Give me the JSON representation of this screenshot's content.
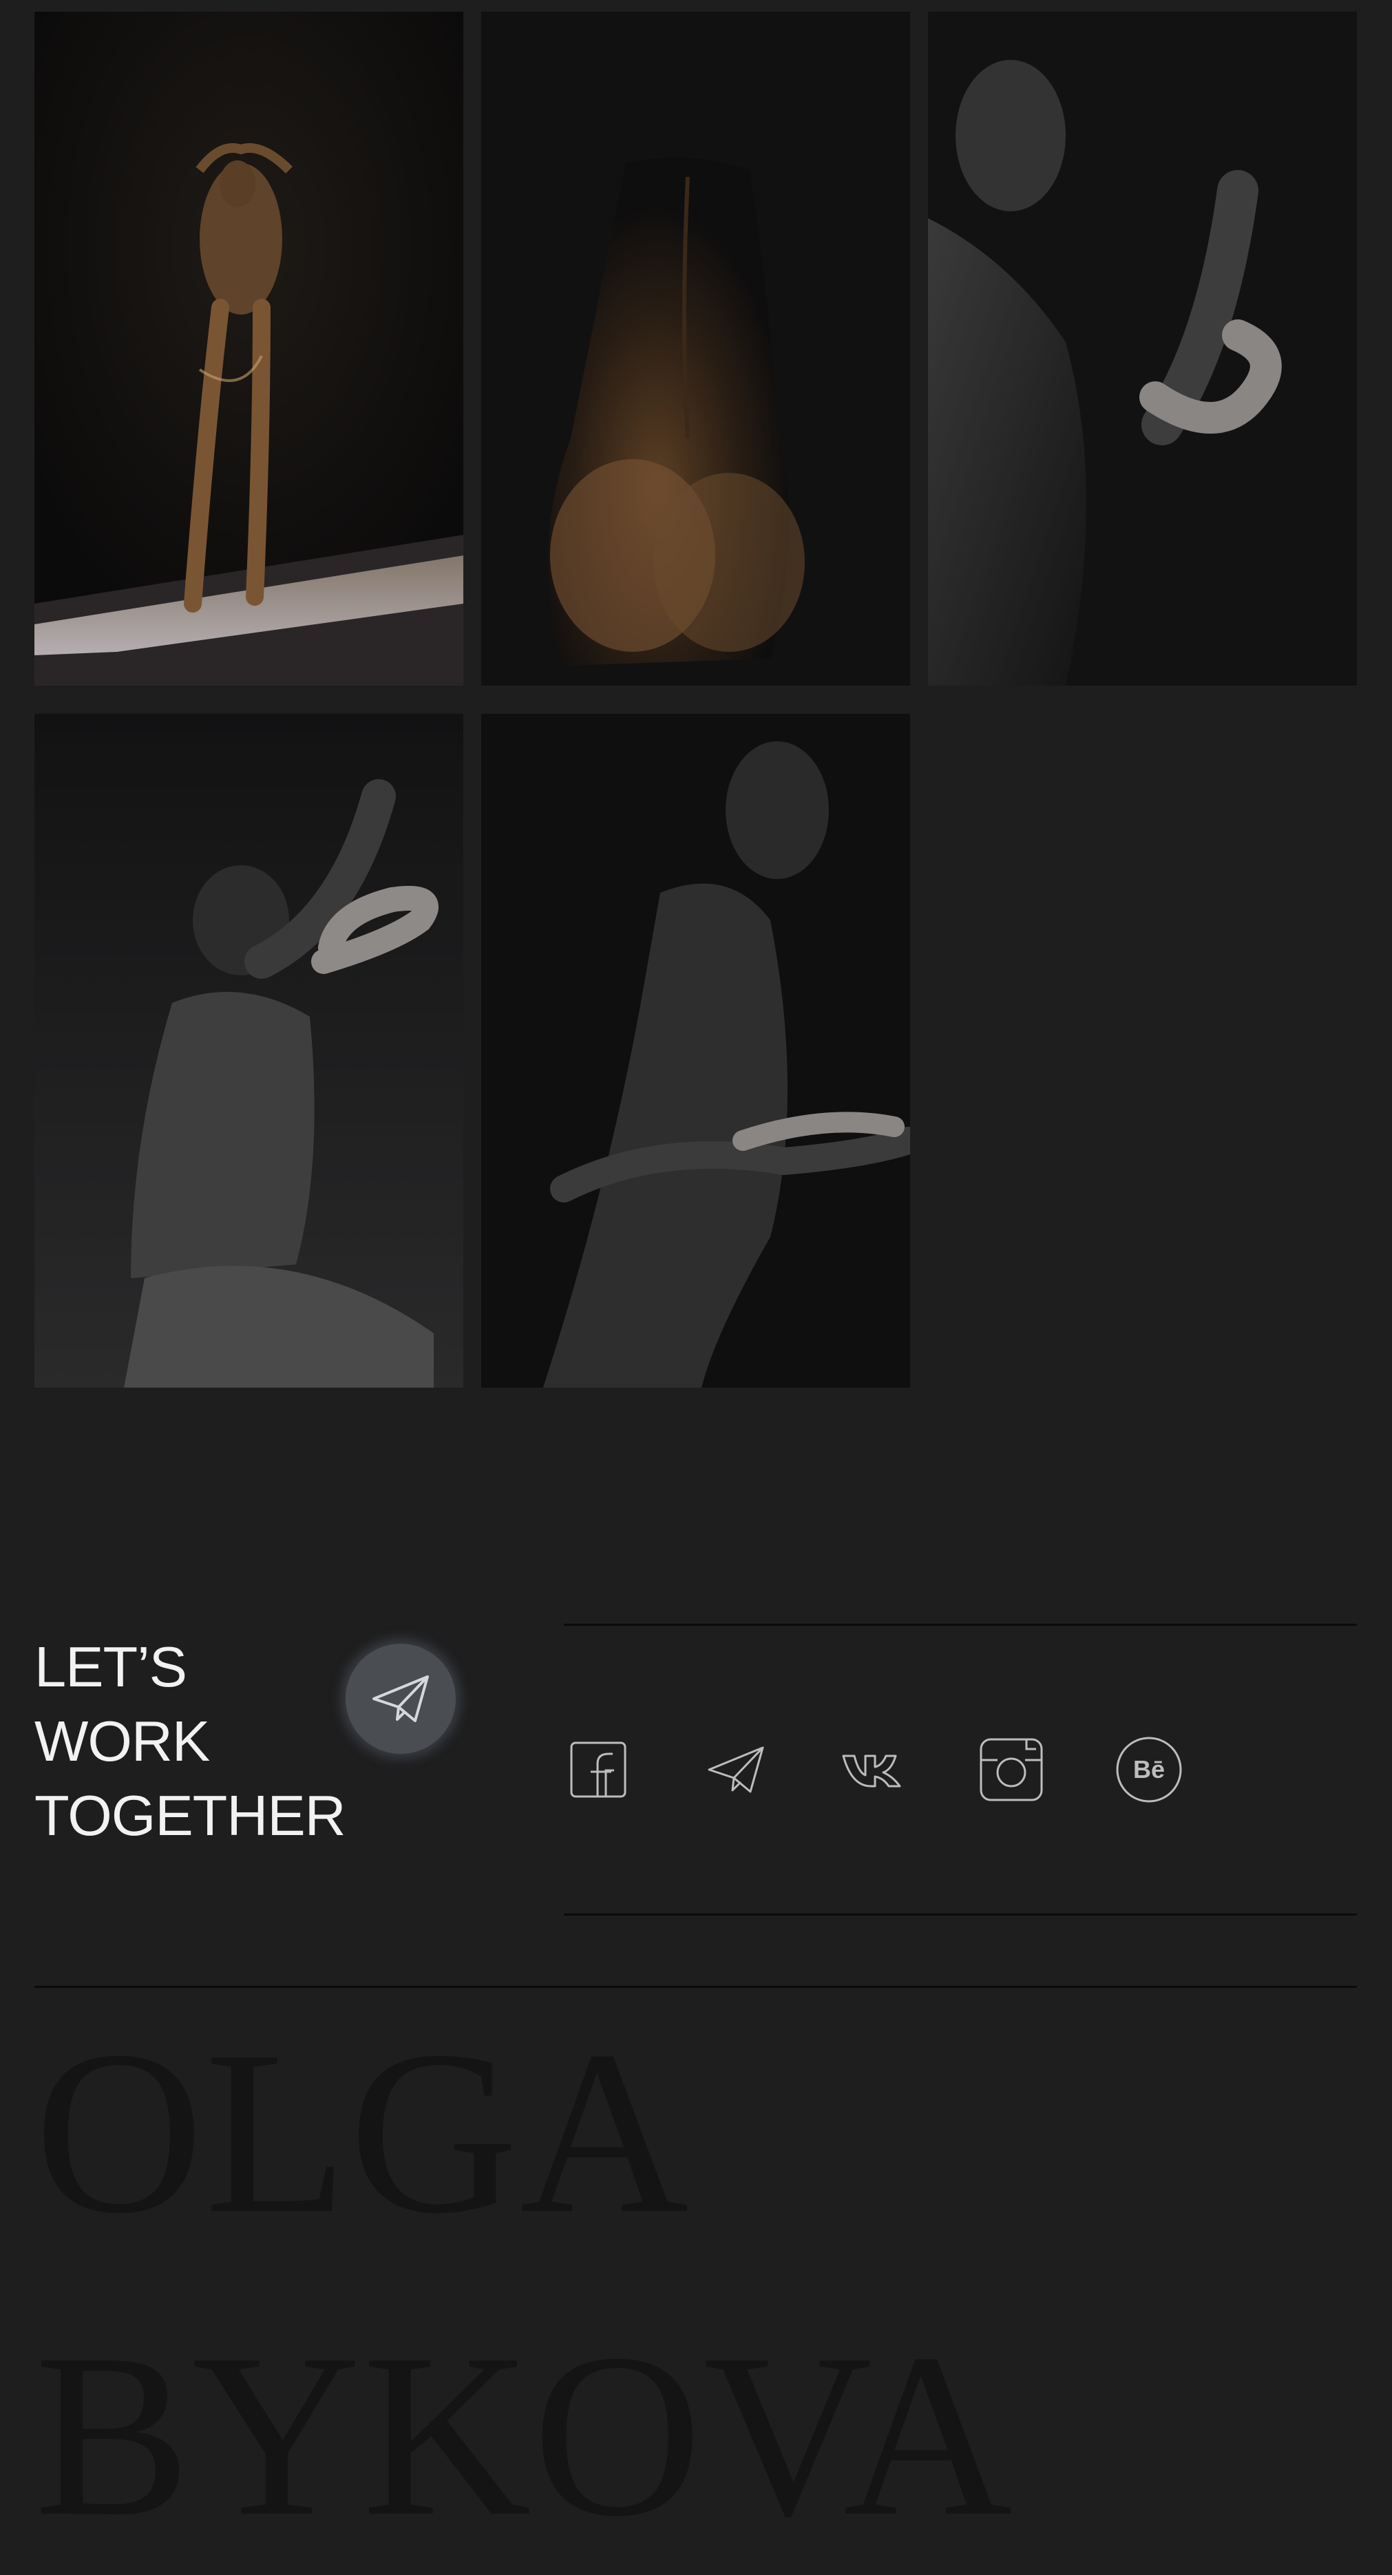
{
  "gallery": {
    "photos": [
      {
        "name": "photo-woman-standing-gold"
      },
      {
        "name": "photo-woman-back-gold"
      },
      {
        "name": "photo-woman-profile-snake"
      },
      {
        "name": "photo-woman-kneeling-snake"
      },
      {
        "name": "photo-woman-snake-arms"
      }
    ]
  },
  "cta": {
    "lines": [
      "LET’S",
      "WORK",
      "TOGETHER"
    ],
    "button_icon": "telegram-send-icon"
  },
  "social": [
    {
      "name": "facebook-icon"
    },
    {
      "name": "telegram-icon"
    },
    {
      "name": "vk-icon"
    },
    {
      "name": "instagram-icon"
    },
    {
      "name": "behance-icon",
      "label": "Bē"
    }
  ],
  "footer": {
    "first_name": "OLGA",
    "last_name": "BYKOVA"
  },
  "colors": {
    "background": "#1e1e1f",
    "text": "#f2f2f2",
    "icon_stroke": "#bdbdbd",
    "name_text": "#141415"
  }
}
